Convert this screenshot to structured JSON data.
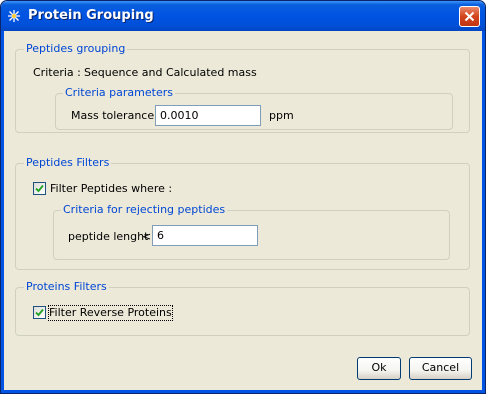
{
  "window": {
    "title": "Protein Grouping",
    "accent_color": "#0054e3",
    "close_icon": "close-x-icon",
    "app_icon": "protein-app-icon"
  },
  "peptides_grouping": {
    "legend": "Peptides grouping",
    "criteria_label": "Criteria :",
    "criteria_value": "Sequence and Calculated mass",
    "criteria_parameters": {
      "legend": "Criteria parameters",
      "mass_tolerance_label": "Mass tolerance :",
      "mass_tolerance_value": "0.0010",
      "unit": "ppm"
    }
  },
  "peptides_filters": {
    "legend": "Peptides Filters",
    "filter_checkbox_label": "Filter Peptides where :",
    "filter_checked": true,
    "rejecting": {
      "legend": "Criteria for rejecting peptides",
      "length_label": "peptide lenght",
      "operator": "<",
      "length_value": "6"
    }
  },
  "proteins_filters": {
    "legend": "Proteins Filters",
    "filter_reverse_label": "Filter Reverse Proteins",
    "filter_reverse_checked": true
  },
  "buttons": {
    "ok": "Ok",
    "cancel": "Cancel"
  }
}
